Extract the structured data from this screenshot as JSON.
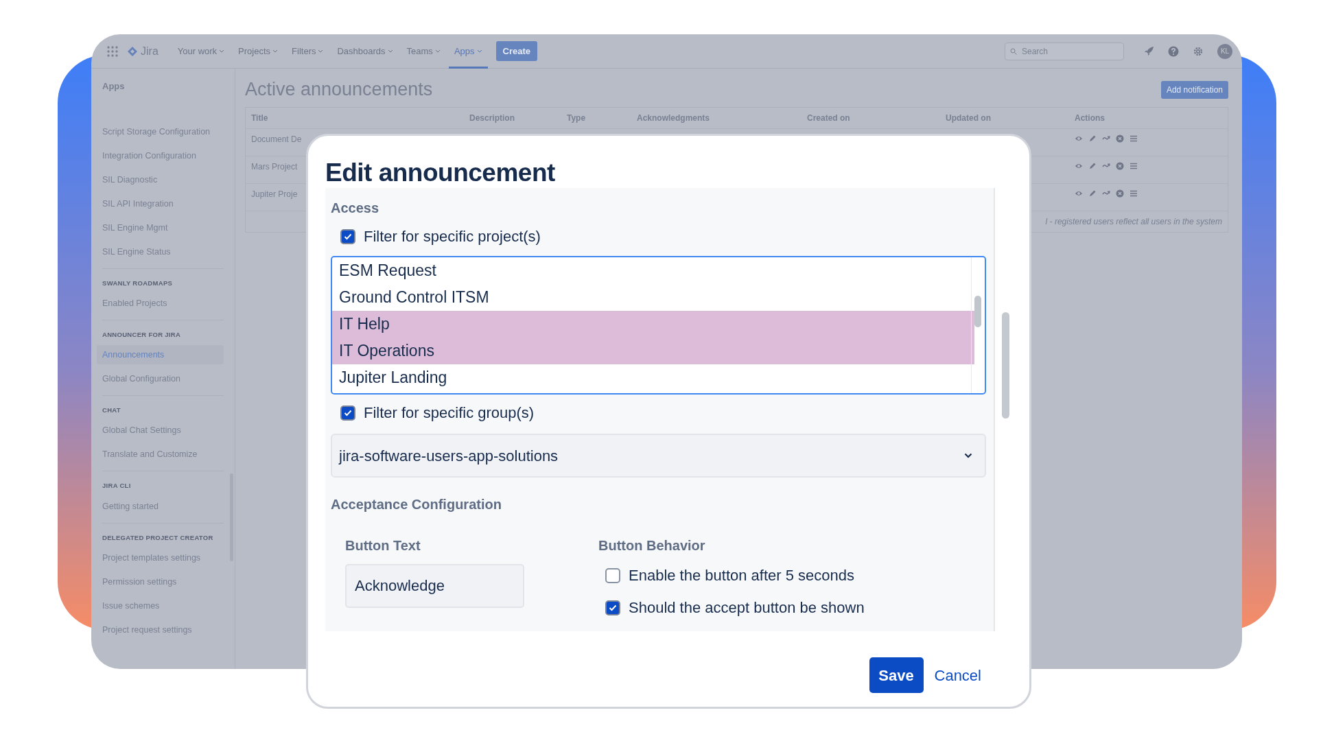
{
  "topbar": {
    "logo": "Jira",
    "nav": [
      {
        "label": "Your work",
        "selected": false
      },
      {
        "label": "Projects",
        "selected": false
      },
      {
        "label": "Filters",
        "selected": false
      },
      {
        "label": "Dashboards",
        "selected": false
      },
      {
        "label": "Teams",
        "selected": false
      },
      {
        "label": "Apps",
        "selected": true
      }
    ],
    "create": "Create",
    "search": {
      "placeholder": "Search"
    },
    "avatar": "KL"
  },
  "sidebar": {
    "title": "Apps",
    "sections": [
      {
        "items": [
          {
            "label": "Script Storage Configuration",
            "selected": false
          },
          {
            "label": "Integration Configuration",
            "selected": false
          },
          {
            "label": "SIL Diagnostic",
            "selected": false
          },
          {
            "label": "SIL API Integration",
            "selected": false
          },
          {
            "label": "SIL Engine Mgmt",
            "selected": false
          },
          {
            "label": "SIL Engine Status",
            "selected": false
          }
        ]
      },
      {
        "heading": "SWANLY ROADMAPS",
        "items": [
          {
            "label": "Enabled Projects",
            "selected": false
          }
        ]
      },
      {
        "heading": "ANNOUNCER FOR JIRA",
        "items": [
          {
            "label": "Announcements",
            "selected": true
          },
          {
            "label": "Global Configuration",
            "selected": false
          }
        ]
      },
      {
        "heading": "CHAT",
        "items": [
          {
            "label": "Global Chat Settings",
            "selected": false
          },
          {
            "label": "Translate and Customize",
            "selected": false
          }
        ]
      },
      {
        "heading": "JIRA CLI",
        "items": [
          {
            "label": "Getting started",
            "selected": false
          }
        ]
      },
      {
        "heading": "DELEGATED PROJECT CREATOR",
        "items": [
          {
            "label": "Project templates settings",
            "selected": false
          },
          {
            "label": "Permission settings",
            "selected": false
          },
          {
            "label": "Issue schemes",
            "selected": false
          },
          {
            "label": "Project request settings",
            "selected": false
          }
        ]
      }
    ]
  },
  "page": {
    "title": "Active announcements",
    "add_button": "Add notification",
    "table": {
      "columns": [
        "Title",
        "Description",
        "Type",
        "Acknowledgments",
        "Created on",
        "Updated on",
        "Actions"
      ],
      "rows": [
        {
          "title": "Document De"
        },
        {
          "title": "Mars Project"
        },
        {
          "title": "Jupiter Proje"
        }
      ],
      "footer": "l - registered users reflect all users in the system"
    }
  },
  "modal": {
    "title": "Edit announcement",
    "access_heading": "Access",
    "project_filter": {
      "label": "Filter for specific project(s)",
      "checked": true
    },
    "projects": [
      {
        "label": "ESM Request",
        "selected": false
      },
      {
        "label": "Ground Control ITSM",
        "selected": false
      },
      {
        "label": "IT Help",
        "selected": true
      },
      {
        "label": "IT Operations",
        "selected": true
      },
      {
        "label": "Jupiter Landing",
        "selected": false
      }
    ],
    "group_filter": {
      "label": "Filter for specific group(s)",
      "checked": true
    },
    "group_select": "jira-software-users-app-solutions",
    "acceptance_heading": "Acceptance Configuration",
    "button_text": {
      "label": "Button Text",
      "value": "Acknowledge"
    },
    "button_behavior": {
      "label": "Button Behavior",
      "options": [
        {
          "label": "Enable the button after 5 seconds",
          "checked": false
        },
        {
          "label": "Should the accept button be shown",
          "checked": true
        }
      ]
    },
    "save": "Save",
    "cancel": "Cancel"
  }
}
